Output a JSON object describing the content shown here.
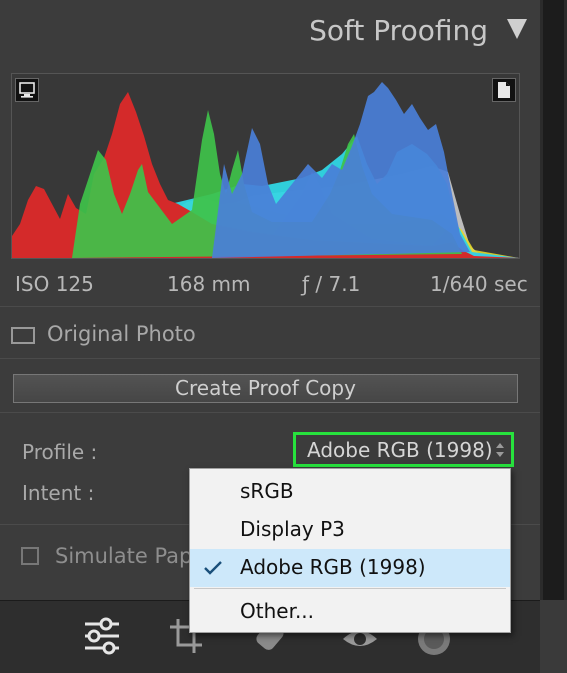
{
  "header": {
    "title": "Soft Proofing"
  },
  "histogram": {
    "left_icon": "monitor-icon",
    "right_icon": "page-warning-icon",
    "exif": {
      "iso": "ISO 125",
      "focal": "168 mm",
      "aperture": "ƒ / 7.1",
      "shutter": "1/640 sec"
    }
  },
  "original_photo": {
    "label": "Original Photo"
  },
  "create_proof": {
    "label": "Create Proof Copy"
  },
  "profile": {
    "label": "Profile :",
    "value": "Adobe RGB (1998)",
    "options": [
      {
        "label": "sRGB",
        "selected": false
      },
      {
        "label": "Display P3",
        "selected": false
      },
      {
        "label": "Adobe RGB (1998)",
        "selected": true
      },
      {
        "label": "Other...",
        "selected": false
      }
    ]
  },
  "intent": {
    "label": "Intent :"
  },
  "simulate": {
    "label": "Simulate Paper & Ink"
  },
  "toolbar": {
    "tools": [
      "sliders-icon",
      "crop-icon",
      "healing-icon",
      "red-eye-icon",
      "mask-icon"
    ]
  },
  "colors": {
    "highlight": "#27e23d",
    "selected_bg": "#cde8fa",
    "menu_bg": "#f2f2f2"
  }
}
